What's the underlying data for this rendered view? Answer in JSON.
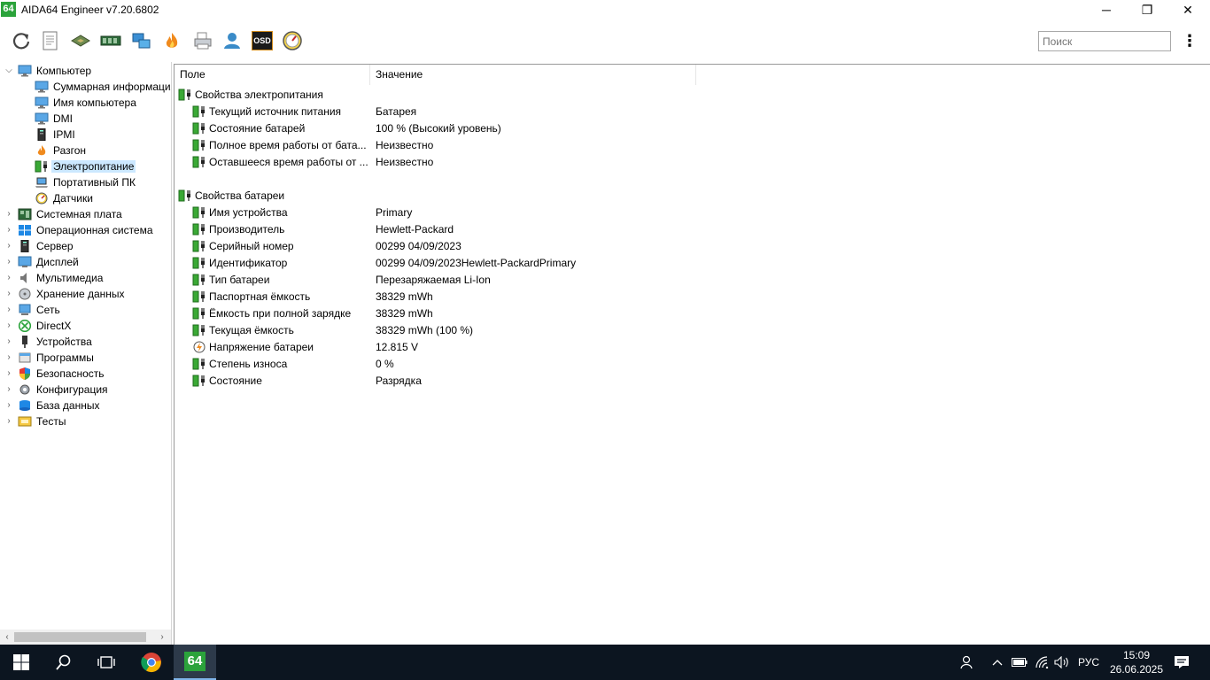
{
  "window": {
    "app_icon_text": "64",
    "title": "AIDA64 Engineer v7.20.6802",
    "min_glyph": "─",
    "restore_glyph": "❐",
    "close_glyph": "✕"
  },
  "toolbar": {
    "search_placeholder": "Поиск",
    "osd_label": "OSD",
    "menu_glyph": "⋮"
  },
  "tree": {
    "items": [
      {
        "label": "Компьютер",
        "icon": "monitor-icon"
      },
      {
        "label": "Суммарная информация",
        "icon": "monitor-icon"
      },
      {
        "label": "Имя компьютера",
        "icon": "monitor-icon"
      },
      {
        "label": "DMI",
        "icon": "monitor-icon"
      },
      {
        "label": "IPMI",
        "icon": "server-icon"
      },
      {
        "label": "Разгон",
        "icon": "flame-icon"
      },
      {
        "label": "Электропитание",
        "icon": "battery-plug-icon"
      },
      {
        "label": "Портативный ПК",
        "icon": "laptop-icon"
      },
      {
        "label": "Датчики",
        "icon": "gauge-icon"
      },
      {
        "label": "Системная плата",
        "icon": "motherboard-icon"
      },
      {
        "label": "Операционная система",
        "icon": "windows-icon"
      },
      {
        "label": "Сервер",
        "icon": "server-icon"
      },
      {
        "label": "Дисплей",
        "icon": "display-icon"
      },
      {
        "label": "Мультимедиа",
        "icon": "speaker-icon"
      },
      {
        "label": "Хранение данных",
        "icon": "disk-icon"
      },
      {
        "label": "Сеть",
        "icon": "network-icon"
      },
      {
        "label": "DirectX",
        "icon": "xbox-icon"
      },
      {
        "label": "Устройства",
        "icon": "device-icon"
      },
      {
        "label": "Программы",
        "icon": "programs-icon"
      },
      {
        "label": "Безопасность",
        "icon": "shield-icon"
      },
      {
        "label": "Конфигурация",
        "icon": "config-icon"
      },
      {
        "label": "База данных",
        "icon": "database-icon"
      },
      {
        "label": "Тесты",
        "icon": "benchmark-icon"
      }
    ]
  },
  "table": {
    "col_field": "Поле",
    "col_value": "Значение",
    "power_section": "Свойства электропитания",
    "power_rows": [
      {
        "field": "Текущий источник питания",
        "value": "Батарея"
      },
      {
        "field": "Состояние батарей",
        "value": "100 % (Высокий уровень)"
      },
      {
        "field": "Полное время работы от бата...",
        "value": "Неизвестно"
      },
      {
        "field": "Оставшееся время работы от ...",
        "value": "Неизвестно"
      }
    ],
    "battery_section": "Свойства батареи",
    "battery_rows": [
      {
        "field": "Имя устройства",
        "value": "Primary"
      },
      {
        "field": "Производитель",
        "value": "Hewlett-Packard"
      },
      {
        "field": "Серийный номер",
        "value": "00299 04/09/2023"
      },
      {
        "field": "Идентификатор",
        "value": "00299 04/09/2023Hewlett-PackardPrimary"
      },
      {
        "field": "Тип батареи",
        "value": "Перезаряжаемая Li-Ion"
      },
      {
        "field": "Паспортная ёмкость",
        "value": "38329 mWh"
      },
      {
        "field": "Ёмкость при полной зарядке",
        "value": "38329 mWh"
      },
      {
        "field": "Текущая ёмкость",
        "value": "38329 mWh  (100 %)"
      },
      {
        "field": "Напряжение батареи",
        "value": "12.815 V"
      },
      {
        "field": "Степень износа",
        "value": "0 %"
      },
      {
        "field": "Состояние",
        "value": "Разрядка"
      }
    ]
  },
  "taskbar": {
    "aida_label": "64",
    "lang": "РУС",
    "time": "15:09",
    "date": "26.06.2025"
  },
  "colors": {
    "selection": "#cce8ff",
    "taskbar": "#0c1520",
    "aida_green": "#2ba33b",
    "battery_green": "#3aa935"
  }
}
